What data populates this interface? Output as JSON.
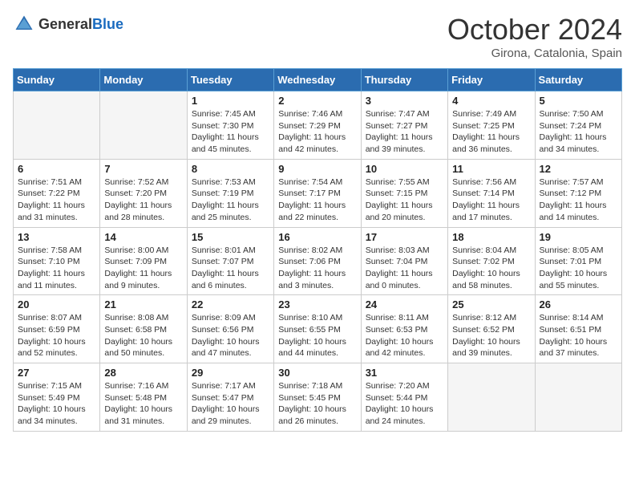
{
  "header": {
    "logo_general": "General",
    "logo_blue": "Blue",
    "month_year": "October 2024",
    "location": "Girona, Catalonia, Spain"
  },
  "days_of_week": [
    "Sunday",
    "Monday",
    "Tuesday",
    "Wednesday",
    "Thursday",
    "Friday",
    "Saturday"
  ],
  "weeks": [
    [
      {
        "num": "",
        "empty": true
      },
      {
        "num": "",
        "empty": true
      },
      {
        "num": "1",
        "sunrise": "7:45 AM",
        "sunset": "7:30 PM",
        "daylight": "11 hours and 45 minutes."
      },
      {
        "num": "2",
        "sunrise": "7:46 AM",
        "sunset": "7:29 PM",
        "daylight": "11 hours and 42 minutes."
      },
      {
        "num": "3",
        "sunrise": "7:47 AM",
        "sunset": "7:27 PM",
        "daylight": "11 hours and 39 minutes."
      },
      {
        "num": "4",
        "sunrise": "7:49 AM",
        "sunset": "7:25 PM",
        "daylight": "11 hours and 36 minutes."
      },
      {
        "num": "5",
        "sunrise": "7:50 AM",
        "sunset": "7:24 PM",
        "daylight": "11 hours and 34 minutes."
      }
    ],
    [
      {
        "num": "6",
        "sunrise": "7:51 AM",
        "sunset": "7:22 PM",
        "daylight": "11 hours and 31 minutes."
      },
      {
        "num": "7",
        "sunrise": "7:52 AM",
        "sunset": "7:20 PM",
        "daylight": "11 hours and 28 minutes."
      },
      {
        "num": "8",
        "sunrise": "7:53 AM",
        "sunset": "7:19 PM",
        "daylight": "11 hours and 25 minutes."
      },
      {
        "num": "9",
        "sunrise": "7:54 AM",
        "sunset": "7:17 PM",
        "daylight": "11 hours and 22 minutes."
      },
      {
        "num": "10",
        "sunrise": "7:55 AM",
        "sunset": "7:15 PM",
        "daylight": "11 hours and 20 minutes."
      },
      {
        "num": "11",
        "sunrise": "7:56 AM",
        "sunset": "7:14 PM",
        "daylight": "11 hours and 17 minutes."
      },
      {
        "num": "12",
        "sunrise": "7:57 AM",
        "sunset": "7:12 PM",
        "daylight": "11 hours and 14 minutes."
      }
    ],
    [
      {
        "num": "13",
        "sunrise": "7:58 AM",
        "sunset": "7:10 PM",
        "daylight": "11 hours and 11 minutes."
      },
      {
        "num": "14",
        "sunrise": "8:00 AM",
        "sunset": "7:09 PM",
        "daylight": "11 hours and 9 minutes."
      },
      {
        "num": "15",
        "sunrise": "8:01 AM",
        "sunset": "7:07 PM",
        "daylight": "11 hours and 6 minutes."
      },
      {
        "num": "16",
        "sunrise": "8:02 AM",
        "sunset": "7:06 PM",
        "daylight": "11 hours and 3 minutes."
      },
      {
        "num": "17",
        "sunrise": "8:03 AM",
        "sunset": "7:04 PM",
        "daylight": "11 hours and 0 minutes."
      },
      {
        "num": "18",
        "sunrise": "8:04 AM",
        "sunset": "7:02 PM",
        "daylight": "10 hours and 58 minutes."
      },
      {
        "num": "19",
        "sunrise": "8:05 AM",
        "sunset": "7:01 PM",
        "daylight": "10 hours and 55 minutes."
      }
    ],
    [
      {
        "num": "20",
        "sunrise": "8:07 AM",
        "sunset": "6:59 PM",
        "daylight": "10 hours and 52 minutes."
      },
      {
        "num": "21",
        "sunrise": "8:08 AM",
        "sunset": "6:58 PM",
        "daylight": "10 hours and 50 minutes."
      },
      {
        "num": "22",
        "sunrise": "8:09 AM",
        "sunset": "6:56 PM",
        "daylight": "10 hours and 47 minutes."
      },
      {
        "num": "23",
        "sunrise": "8:10 AM",
        "sunset": "6:55 PM",
        "daylight": "10 hours and 44 minutes."
      },
      {
        "num": "24",
        "sunrise": "8:11 AM",
        "sunset": "6:53 PM",
        "daylight": "10 hours and 42 minutes."
      },
      {
        "num": "25",
        "sunrise": "8:12 AM",
        "sunset": "6:52 PM",
        "daylight": "10 hours and 39 minutes."
      },
      {
        "num": "26",
        "sunrise": "8:14 AM",
        "sunset": "6:51 PM",
        "daylight": "10 hours and 37 minutes."
      }
    ],
    [
      {
        "num": "27",
        "sunrise": "7:15 AM",
        "sunset": "5:49 PM",
        "daylight": "10 hours and 34 minutes."
      },
      {
        "num": "28",
        "sunrise": "7:16 AM",
        "sunset": "5:48 PM",
        "daylight": "10 hours and 31 minutes."
      },
      {
        "num": "29",
        "sunrise": "7:17 AM",
        "sunset": "5:47 PM",
        "daylight": "10 hours and 29 minutes."
      },
      {
        "num": "30",
        "sunrise": "7:18 AM",
        "sunset": "5:45 PM",
        "daylight": "10 hours and 26 minutes."
      },
      {
        "num": "31",
        "sunrise": "7:20 AM",
        "sunset": "5:44 PM",
        "daylight": "10 hours and 24 minutes."
      },
      {
        "num": "",
        "empty": true
      },
      {
        "num": "",
        "empty": true
      }
    ]
  ]
}
